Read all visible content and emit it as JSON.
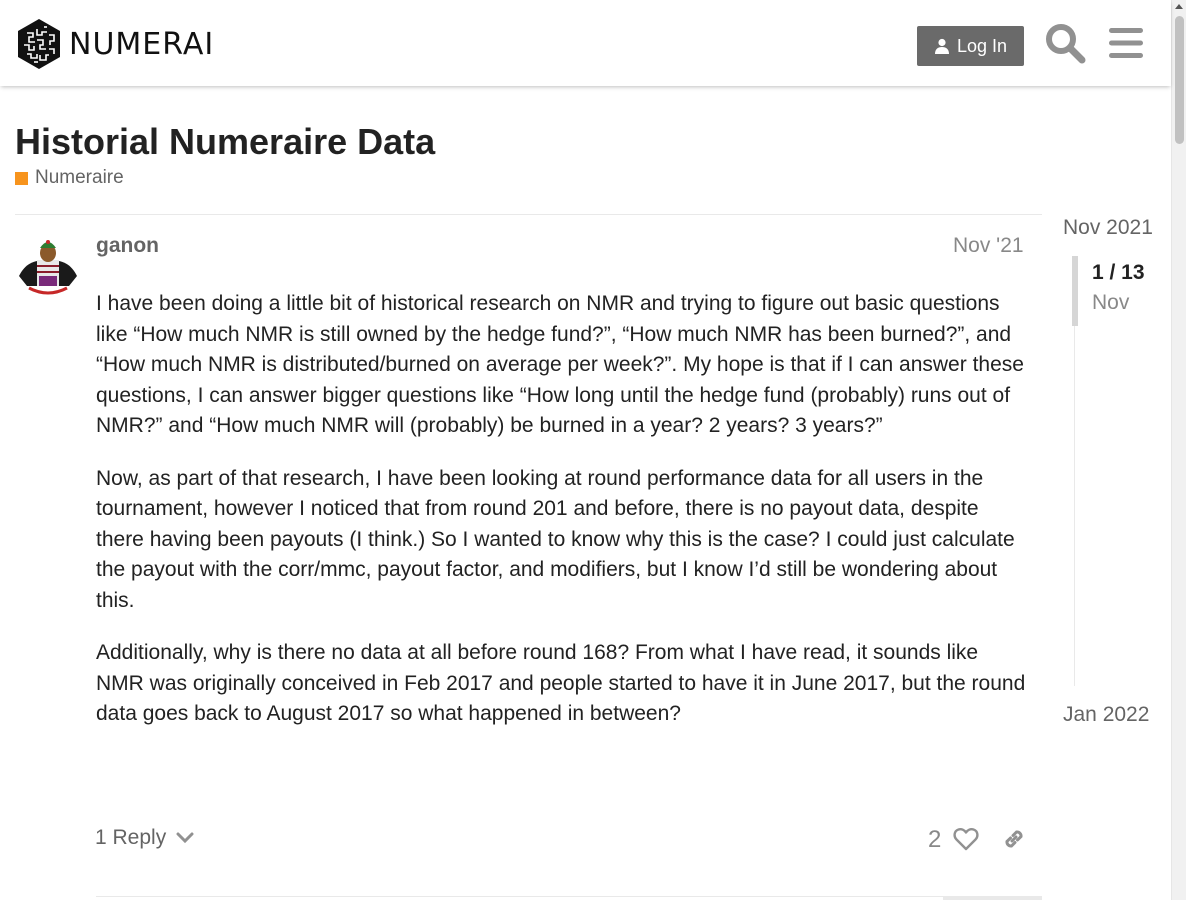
{
  "header": {
    "logo_text": "NUMERAI",
    "login_label": "Log In",
    "icons": [
      "search-icon",
      "hamburger-menu-icon",
      "user-icon"
    ]
  },
  "topic": {
    "title": "Historial Numeraire Data",
    "category": {
      "name": "Numeraire",
      "color": "#F7941D"
    }
  },
  "post": {
    "username": "ganon",
    "date": "Nov '21",
    "paragraphs": [
      "I have been doing a little bit of historical research on NMR and trying to figure out basic questions like “How much NMR is still owned by the hedge fund?”, “How much NMR has been burned?”, and “How much NMR is distributed/burned on average per week?”. My hope is that if I can answer these questions, I can answer bigger questions like “How long until the hedge fund (probably) runs out of NMR?” and “How much NMR will (probably) be burned in a year? 2 years? 3 years?”",
      "Now, as part of that research, I have been looking at round performance data for all users in the tournament, however I noticed that from round 201 and before, there is no payout data, despite there having been payouts (I think.) So I wanted to know why this is the case? I could just calculate the payout with the corr/mmc, payout factor, and modifiers, but I know I’d still be wondering about this.",
      "Additionally, why is there no data at all before round 168? From what I have read, it sounds like NMR was originally conceived in Feb 2017 and people started to have it in June 2017, but the round data goes back to August 2017 so what happened in between?"
    ],
    "replies_label": "1 Reply",
    "like_count": "2"
  },
  "timeline": {
    "start": "Nov 2021",
    "progress": "1 / 13",
    "month": "Nov",
    "end": "Jan 2022",
    "position_fraction": 0.077
  },
  "colors": {
    "button_bg": "#6a6a6a",
    "text_primary": "#222222",
    "text_muted": "#646464",
    "category": "#F7941D"
  }
}
